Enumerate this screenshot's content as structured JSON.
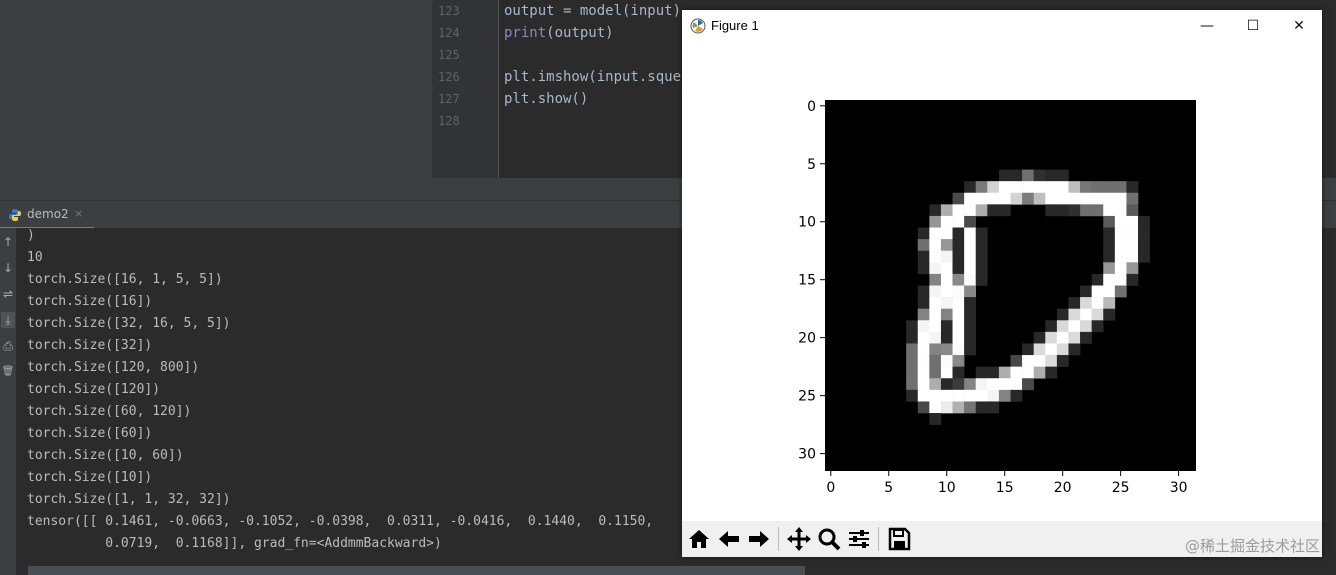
{
  "editor": {
    "lines": [
      {
        "num": "123",
        "parts": [
          {
            "t": "output = model(input)",
            "kw": false
          }
        ]
      },
      {
        "num": "124",
        "parts": [
          {
            "t": "print",
            "kw": true
          },
          {
            "t": "(output)",
            "kw": false
          }
        ]
      },
      {
        "num": "125",
        "parts": []
      },
      {
        "num": "126",
        "parts": [
          {
            "t": "plt.imshow(input.squee",
            "kw": false
          }
        ]
      },
      {
        "num": "127",
        "parts": [
          {
            "t": "plt.show()",
            "kw": false
          }
        ]
      },
      {
        "num": "128",
        "parts": []
      }
    ]
  },
  "run_panel": {
    "tab_label": "demo2",
    "tab_close": "×",
    "tools": [
      "↑",
      "↓",
      "⇌",
      "⤓",
      "⎙",
      "🗑"
    ],
    "output": [
      ")",
      "10",
      "torch.Size([16, 1, 5, 5])",
      "torch.Size([16])",
      "torch.Size([32, 16, 5, 5])",
      "torch.Size([32])",
      "torch.Size([120, 800])",
      "torch.Size([120])",
      "torch.Size([60, 120])",
      "torch.Size([60])",
      "torch.Size([10, 60])",
      "torch.Size([10])",
      "torch.Size([1, 1, 32, 32])",
      "tensor([[ 0.1461, -0.0663, -0.1052, -0.0398,  0.0311, -0.0416,  0.1440,  0.1150,",
      "          0.0719,  0.1168]], grad_fn=<AddmmBackward>)"
    ]
  },
  "figure": {
    "title": "Figure 1",
    "controls": {
      "minimize": "—",
      "maximize": "☐",
      "close": "✕"
    },
    "toolbar": [
      "home-icon",
      "back-icon",
      "forward-icon",
      "pan-icon",
      "zoom-icon",
      "configure-icon",
      "save-icon"
    ],
    "watermark": "@稀土掘金技术社区"
  },
  "chart_data": {
    "type": "heatmap",
    "colormap": "gray",
    "background": "#000000",
    "image_size": [
      32,
      32
    ],
    "description_of_content": "",
    "x_ticks": [
      0,
      5,
      10,
      15,
      20,
      25,
      30
    ],
    "y_ticks": [
      0,
      5,
      10,
      15,
      20,
      25,
      30
    ],
    "xlim": [
      -0.5,
      31.5
    ],
    "ylim": [
      31.5,
      -0.5
    ],
    "stroke_path": [
      [
        25,
        8
      ],
      [
        22,
        8
      ],
      [
        17,
        7
      ],
      [
        13,
        8
      ],
      [
        10,
        10
      ],
      [
        9,
        12
      ],
      [
        10,
        15
      ],
      [
        9,
        18
      ],
      [
        8,
        21
      ],
      [
        8,
        24
      ],
      [
        9,
        25.5
      ],
      [
        12,
        25
      ],
      [
        15,
        24
      ],
      [
        18,
        22
      ],
      [
        21,
        19
      ],
      [
        23,
        17
      ],
      [
        24.5,
        15
      ],
      [
        25.5,
        13
      ],
      [
        25.5,
        10
      ],
      [
        24,
        8.5
      ]
    ],
    "inner_stroke": [
      [
        12,
        11
      ],
      [
        12,
        14
      ],
      [
        11,
        17
      ],
      [
        11,
        20
      ],
      [
        10,
        23
      ]
    ]
  }
}
